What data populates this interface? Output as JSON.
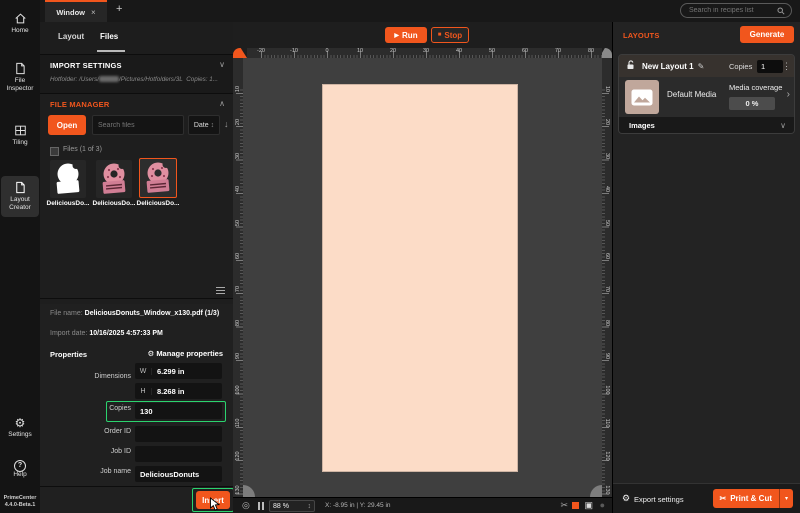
{
  "app": {
    "name": "PrimeCenter",
    "version": "4.4.0-Beta.1"
  },
  "colors": {
    "accent": "#f1561d",
    "highlight_green": "#2bd36e",
    "media_fill": "#fcdcc7",
    "canvas_bg": "#3f3f3f"
  },
  "icons": {
    "play": "▶",
    "stop_square": "■",
    "plus": "+",
    "close": "×",
    "pencil": "✎",
    "dots_menu": "⋮",
    "chevron_down": "∨",
    "chevron_up": "∧",
    "chevron_right": "›",
    "arrow_down": "↓",
    "sort_updown": "↕",
    "stepper_updown": "↕",
    "gear": "⚙",
    "question": "?",
    "scissors": "✂",
    "fit_view": "◎",
    "register": "▣",
    "dot": "●"
  },
  "topbar": {
    "tab_label": "Window",
    "search_placeholder": "Search in recipes list"
  },
  "sidebar": {
    "items": [
      {
        "label": "Home"
      },
      {
        "label": "File Inspector"
      },
      {
        "label": "Tiling"
      },
      {
        "label": "Layout Creator",
        "active": true
      },
      {
        "label": "Settings"
      },
      {
        "label": "Help"
      }
    ]
  },
  "left_panel": {
    "tabs": [
      {
        "label": "Layout"
      },
      {
        "label": "Files",
        "active": true
      }
    ],
    "import_settings": {
      "title": "IMPORT SETTINGS",
      "hotfolder_prefix": "Hotfolder: /Users/",
      "hotfolder_suffix": "/Pictures/Hotfolders/3L",
      "copies_note": "Copies: 1..."
    },
    "file_manager": {
      "title": "FILE MANAGER",
      "open_button": "Open",
      "search_placeholder": "Search files",
      "sort_label": "Date",
      "files_header": "Files (1 of 3)",
      "files": [
        {
          "label": "DeliciousDo..."
        },
        {
          "label": "DeliciousDo..."
        },
        {
          "label": "DeliciousDo...",
          "selected": true
        }
      ]
    },
    "details": {
      "file_name_label": "File name:",
      "file_name": "DeliciousDonuts_Window_x130.pdf (1/3)",
      "import_date_label": "Import date:",
      "import_date": "10/16/2025 4:57:33 PM",
      "properties_label": "Properties",
      "manage_properties": "Manage properties",
      "dimensions_label": "Dimensions",
      "w_label": "W",
      "w_value": "6.299 in",
      "h_label": "H",
      "h_value": "8.268 in",
      "copies_label": "Copies",
      "copies_value": "130",
      "order_id_label": "Order ID",
      "job_id_label": "Job ID",
      "job_name_label": "Job name",
      "job_name_value": "DeliciousDonuts",
      "insert_button": "Insert"
    }
  },
  "canvas": {
    "run_button": "Run",
    "stop_button": "Stop",
    "ruler_h_labels": [
      "-20",
      "-10",
      "0",
      "10",
      "20",
      "30",
      "40",
      "50",
      "60",
      "70",
      "80"
    ],
    "ruler_v_labels": [
      "10",
      "20",
      "30",
      "40",
      "50",
      "60",
      "70",
      "80",
      "90",
      "100",
      "110",
      "120",
      "130"
    ],
    "statusbar": {
      "zoom": "88 %",
      "coords": "X: -8.95 in | Y: 29.45 in"
    }
  },
  "right_panel": {
    "title": "LAYOUTS",
    "generate_button": "Generate",
    "layout_card": {
      "name": "New Layout 1",
      "copies_label": "Copies",
      "copies_value": "1",
      "media_name": "Default Media",
      "coverage_label": "Media coverage",
      "coverage_value": "0 %",
      "images_label": "Images"
    },
    "footer": {
      "export_settings": "Export settings",
      "print_cut_button": "Print & Cut"
    }
  }
}
